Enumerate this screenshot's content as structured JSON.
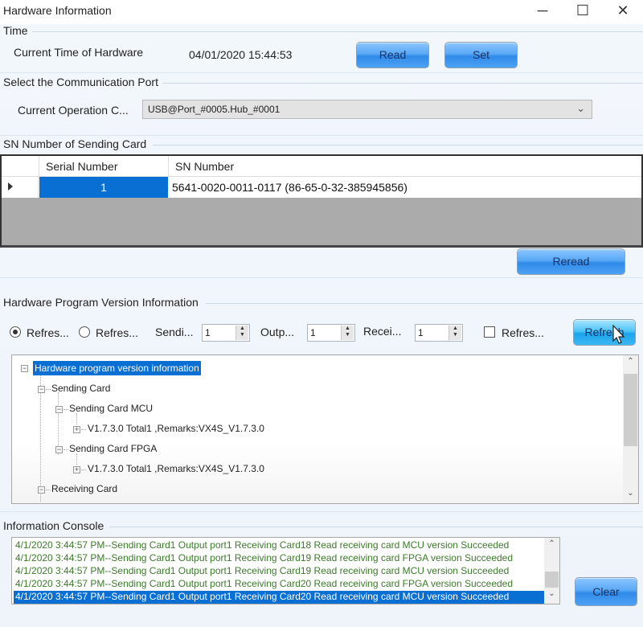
{
  "window": {
    "title": "Hardware Information",
    "controls": {
      "minimize": "─",
      "maximize": "☐",
      "close": "✕"
    }
  },
  "time_group": {
    "label": "Time",
    "current_time_label": "Current Time of Hardware",
    "current_time_value": "04/01/2020 15:44:53",
    "read_button": "Read",
    "set_button": "Set"
  },
  "port_group": {
    "label": "Select the Communication Port",
    "current_operation_label": "Current Operation C...",
    "selected_port": "USB@Port_#0005.Hub_#0001"
  },
  "sn_group": {
    "label": "SN Number of Sending Card",
    "columns": [
      "Serial Number",
      "SN Number"
    ],
    "rows": [
      {
        "serial": "1",
        "sn": "5641-0020-0011-0117  (86-65-0-32-385945856)"
      }
    ],
    "reread_button": "Reread"
  },
  "version_group": {
    "label": "Hardware Program Version Information",
    "radio_options": [
      {
        "label": "Refres...",
        "checked": true
      },
      {
        "label": "Refres...",
        "checked": false
      }
    ],
    "sending_label": "Sendi...",
    "sending_value": "1",
    "output_label": "Outp...",
    "output_value": "1",
    "receiving_label": "Recei...",
    "receiving_value": "1",
    "checkbox_label": "Refres...",
    "checkbox_checked": false,
    "refresh_button": "Refresh",
    "tree": {
      "root": "Hardware program version information",
      "sending_card": "Sending Card",
      "sending_card_mcu": "Sending Card MCU",
      "mcu_version": "V1.7.3.0 Total1 ,Remarks:VX4S_V1.7.3.0",
      "sending_card_fpga": "Sending Card FPGA",
      "fpga_version": "V1.7.3.0 Total1 ,Remarks:VX4S_V1.7.3.0",
      "receiving_card": "Receiving Card"
    }
  },
  "console_group": {
    "label": "Information Console",
    "lines": [
      "4/1/2020 3:44:57 PM--Sending Card1 Output port1 Receiving Card18 Read receiving card MCU version Succeeded",
      "4/1/2020 3:44:57 PM--Sending Card1 Output port1 Receiving Card19 Read receiving card FPGA version Succeeded",
      "4/1/2020 3:44:57 PM--Sending Card1 Output port1 Receiving Card19 Read receiving card MCU version Succeeded",
      "4/1/2020 3:44:57 PM--Sending Card1 Output port1 Receiving Card20 Read receiving card FPGA version Succeeded",
      "4/1/2020 3:44:57 PM--Sending Card1 Output port1 Receiving Card20 Read receiving card MCU version Succeeded"
    ],
    "selected_line_index": 4,
    "clear_button": "Clear"
  },
  "colors": {
    "selection": "#0a6fd2",
    "console_text": "#3b7a2a",
    "button_text": "#1c3263"
  }
}
